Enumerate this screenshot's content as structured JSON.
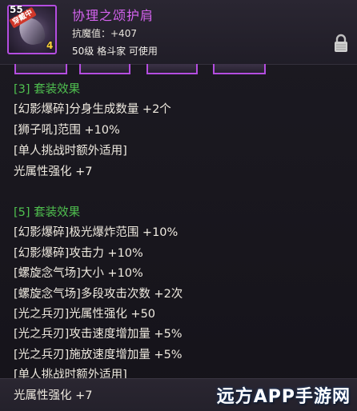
{
  "item": {
    "level": "55",
    "equipped_badge": "穿戴中",
    "plus": "4",
    "name": "协理之颂护肩",
    "stat": "抗魔值：+407",
    "requirement": "50级 格斗家 可使用"
  },
  "set3": {
    "title": "[3] 套装效果",
    "lines": [
      "[幻影爆碎]分身生成数量 +2个",
      "[狮子吼]范围 +10%",
      "[单人挑战时额外适用]",
      "光属性强化 +7"
    ]
  },
  "set5": {
    "title": "[5] 套装效果",
    "lines": [
      "[幻影爆碎]极光爆炸范围 +10%",
      "[幻影爆碎]攻击力 +10%",
      "[螺旋念气场]大小 +10%",
      "[螺旋念气场]多段攻击次数 +2次",
      "[光之兵刃]光属性强化 +50",
      "[光之兵刃]攻击速度增加量 +5%",
      "[光之兵刃]施放速度增加量 +5%",
      "[单人挑战时额外适用]",
      "光属性强化 +7"
    ]
  },
  "watermark": "远方APP手游网",
  "colors": {
    "item_name": "#d563ef",
    "set_header": "#4fc04f",
    "frame": "#b44de0"
  }
}
